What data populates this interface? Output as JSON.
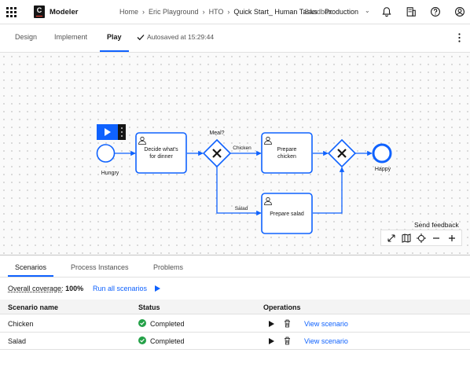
{
  "header": {
    "app_name": "Modeler",
    "logo_letter": "C",
    "breadcrumbs": [
      "Home",
      "Eric Playground",
      "HTO"
    ],
    "current_file": "Quick Start_ Human Tasks",
    "current_overlap": "Sandbox",
    "environment": "Production",
    "icons": [
      "notification-icon",
      "organization-icon",
      "help-icon",
      "user-icon"
    ]
  },
  "tabs": {
    "items": [
      "Design",
      "Implement",
      "Play"
    ],
    "active": "Play",
    "autosave": "Autosaved at 15:29:44"
  },
  "diagram": {
    "start_event": "Hungry",
    "task1": [
      "Decide what's",
      "for dinner"
    ],
    "gateway_question": "Meal?",
    "flow_chicken": "Chicken",
    "flow_salad": "Salad",
    "task_chicken": [
      "Prepare",
      "chicken"
    ],
    "task_salad": "Prepare salad",
    "end_event": "Happy",
    "accent": "#0f62fe"
  },
  "canvas": {
    "feedback": "Send feedback",
    "zoom_controls": [
      "fit-to-screen-icon",
      "minimap-icon",
      "center-icon",
      "zoom-out-icon",
      "zoom-in-icon"
    ]
  },
  "panel": {
    "tabs": [
      "Scenarios",
      "Process Instances",
      "Problems"
    ],
    "active_tab": "Scenarios",
    "coverage_label": "Overall coverage:",
    "coverage_value": "100%",
    "run_all": "Run all scenarios",
    "columns": [
      "Scenario name",
      "Status",
      "Operations"
    ],
    "rows": [
      {
        "name": "Chicken",
        "status": "Completed",
        "link": "View scenario"
      },
      {
        "name": "Salad",
        "status": "Completed",
        "link": "View scenario"
      }
    ],
    "status_color": "#24a148"
  }
}
